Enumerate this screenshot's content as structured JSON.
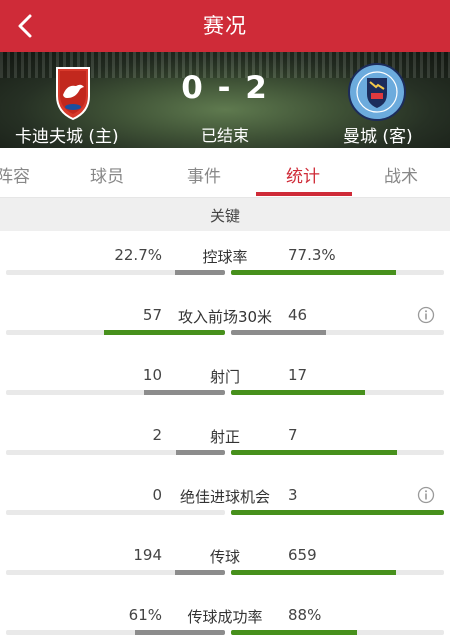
{
  "header": {
    "title": "赛况",
    "back_icon": "chevron-left-icon"
  },
  "match": {
    "home_team": "卡迪夫城 (主)",
    "away_team": "曼城 (客)",
    "score": "0 - 2",
    "status": "已结束",
    "home_crest": "cardiff-city-crest",
    "away_crest": "manchester-city-crest"
  },
  "tabs": [
    "阵容",
    "球员",
    "事件",
    "统计",
    "战术"
  ],
  "active_tab": "统计",
  "section_title": "关键",
  "colors": {
    "brand": "#cf2b38",
    "win_bar": "#47901c",
    "lose_bar": "#8c8c8c",
    "track": "#e9e9e9"
  },
  "stats": [
    {
      "label": "控球率",
      "home": "22.7%",
      "away": "77.3%",
      "home_ratio": 0.227,
      "away_ratio": 0.773,
      "info": false
    },
    {
      "label": "攻入前场30米",
      "home": "57",
      "away": "46",
      "home_ratio": 0.553,
      "away_ratio": 0.447,
      "info": true
    },
    {
      "label": "射门",
      "home": "10",
      "away": "17",
      "home_ratio": 0.37,
      "away_ratio": 0.63,
      "info": false
    },
    {
      "label": "射正",
      "home": "2",
      "away": "7",
      "home_ratio": 0.222,
      "away_ratio": 0.778,
      "info": false
    },
    {
      "label": "绝佳进球机会",
      "home": "0",
      "away": "3",
      "home_ratio": 0.0,
      "away_ratio": 1.0,
      "info": true
    },
    {
      "label": "传球",
      "home": "194",
      "away": "659",
      "home_ratio": 0.227,
      "away_ratio": 0.773,
      "info": false
    },
    {
      "label": "传球成功率",
      "home": "61%",
      "away": "88%",
      "home_ratio": 0.409,
      "away_ratio": 0.591,
      "info": false
    }
  ]
}
